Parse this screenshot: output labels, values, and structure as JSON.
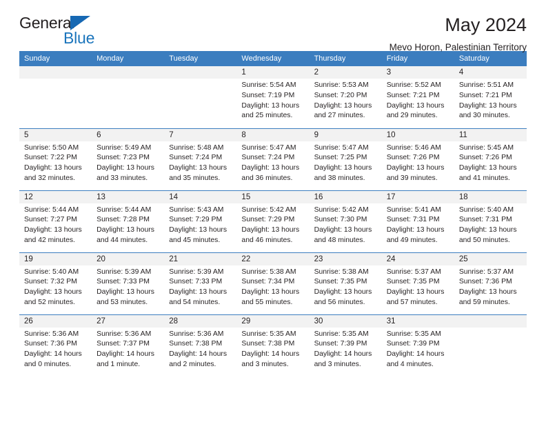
{
  "brand": {
    "name_primary": "General",
    "name_secondary": "Blue",
    "triangle_color": "#1668b3",
    "secondary_color": "#1b75bc"
  },
  "header": {
    "title": "May 2024",
    "subtitle": "Mevo Horon, Palestinian Territory"
  },
  "theme": {
    "header_row_bg": "#3b7dbf",
    "daynum_bg": "#f2f2f2",
    "text_color": "#231f20"
  },
  "calendar": {
    "weekday_headers": [
      "Sunday",
      "Monday",
      "Tuesday",
      "Wednesday",
      "Thursday",
      "Friday",
      "Saturday"
    ],
    "labels": {
      "sunrise": "Sunrise:",
      "sunset": "Sunset:",
      "daylight": "Daylight:"
    },
    "weeks": [
      [
        {
          "day": "",
          "blank": true
        },
        {
          "day": "",
          "blank": true
        },
        {
          "day": "",
          "blank": true
        },
        {
          "day": "1",
          "sunrise": "Sunrise: 5:54 AM",
          "sunset": "Sunset: 7:19 PM",
          "daylight": "Daylight: 13 hours and 25 minutes."
        },
        {
          "day": "2",
          "sunrise": "Sunrise: 5:53 AM",
          "sunset": "Sunset: 7:20 PM",
          "daylight": "Daylight: 13 hours and 27 minutes."
        },
        {
          "day": "3",
          "sunrise": "Sunrise: 5:52 AM",
          "sunset": "Sunset: 7:21 PM",
          "daylight": "Daylight: 13 hours and 29 minutes."
        },
        {
          "day": "4",
          "sunrise": "Sunrise: 5:51 AM",
          "sunset": "Sunset: 7:21 PM",
          "daylight": "Daylight: 13 hours and 30 minutes."
        }
      ],
      [
        {
          "day": "5",
          "sunrise": "Sunrise: 5:50 AM",
          "sunset": "Sunset: 7:22 PM",
          "daylight": "Daylight: 13 hours and 32 minutes."
        },
        {
          "day": "6",
          "sunrise": "Sunrise: 5:49 AM",
          "sunset": "Sunset: 7:23 PM",
          "daylight": "Daylight: 13 hours and 33 minutes."
        },
        {
          "day": "7",
          "sunrise": "Sunrise: 5:48 AM",
          "sunset": "Sunset: 7:24 PM",
          "daylight": "Daylight: 13 hours and 35 minutes."
        },
        {
          "day": "8",
          "sunrise": "Sunrise: 5:47 AM",
          "sunset": "Sunset: 7:24 PM",
          "daylight": "Daylight: 13 hours and 36 minutes."
        },
        {
          "day": "9",
          "sunrise": "Sunrise: 5:47 AM",
          "sunset": "Sunset: 7:25 PM",
          "daylight": "Daylight: 13 hours and 38 minutes."
        },
        {
          "day": "10",
          "sunrise": "Sunrise: 5:46 AM",
          "sunset": "Sunset: 7:26 PM",
          "daylight": "Daylight: 13 hours and 39 minutes."
        },
        {
          "day": "11",
          "sunrise": "Sunrise: 5:45 AM",
          "sunset": "Sunset: 7:26 PM",
          "daylight": "Daylight: 13 hours and 41 minutes."
        }
      ],
      [
        {
          "day": "12",
          "sunrise": "Sunrise: 5:44 AM",
          "sunset": "Sunset: 7:27 PM",
          "daylight": "Daylight: 13 hours and 42 minutes."
        },
        {
          "day": "13",
          "sunrise": "Sunrise: 5:44 AM",
          "sunset": "Sunset: 7:28 PM",
          "daylight": "Daylight: 13 hours and 44 minutes."
        },
        {
          "day": "14",
          "sunrise": "Sunrise: 5:43 AM",
          "sunset": "Sunset: 7:29 PM",
          "daylight": "Daylight: 13 hours and 45 minutes."
        },
        {
          "day": "15",
          "sunrise": "Sunrise: 5:42 AM",
          "sunset": "Sunset: 7:29 PM",
          "daylight": "Daylight: 13 hours and 46 minutes."
        },
        {
          "day": "16",
          "sunrise": "Sunrise: 5:42 AM",
          "sunset": "Sunset: 7:30 PM",
          "daylight": "Daylight: 13 hours and 48 minutes."
        },
        {
          "day": "17",
          "sunrise": "Sunrise: 5:41 AM",
          "sunset": "Sunset: 7:31 PM",
          "daylight": "Daylight: 13 hours and 49 minutes."
        },
        {
          "day": "18",
          "sunrise": "Sunrise: 5:40 AM",
          "sunset": "Sunset: 7:31 PM",
          "daylight": "Daylight: 13 hours and 50 minutes."
        }
      ],
      [
        {
          "day": "19",
          "sunrise": "Sunrise: 5:40 AM",
          "sunset": "Sunset: 7:32 PM",
          "daylight": "Daylight: 13 hours and 52 minutes."
        },
        {
          "day": "20",
          "sunrise": "Sunrise: 5:39 AM",
          "sunset": "Sunset: 7:33 PM",
          "daylight": "Daylight: 13 hours and 53 minutes."
        },
        {
          "day": "21",
          "sunrise": "Sunrise: 5:39 AM",
          "sunset": "Sunset: 7:33 PM",
          "daylight": "Daylight: 13 hours and 54 minutes."
        },
        {
          "day": "22",
          "sunrise": "Sunrise: 5:38 AM",
          "sunset": "Sunset: 7:34 PM",
          "daylight": "Daylight: 13 hours and 55 minutes."
        },
        {
          "day": "23",
          "sunrise": "Sunrise: 5:38 AM",
          "sunset": "Sunset: 7:35 PM",
          "daylight": "Daylight: 13 hours and 56 minutes."
        },
        {
          "day": "24",
          "sunrise": "Sunrise: 5:37 AM",
          "sunset": "Sunset: 7:35 PM",
          "daylight": "Daylight: 13 hours and 57 minutes."
        },
        {
          "day": "25",
          "sunrise": "Sunrise: 5:37 AM",
          "sunset": "Sunset: 7:36 PM",
          "daylight": "Daylight: 13 hours and 59 minutes."
        }
      ],
      [
        {
          "day": "26",
          "sunrise": "Sunrise: 5:36 AM",
          "sunset": "Sunset: 7:36 PM",
          "daylight": "Daylight: 14 hours and 0 minutes."
        },
        {
          "day": "27",
          "sunrise": "Sunrise: 5:36 AM",
          "sunset": "Sunset: 7:37 PM",
          "daylight": "Daylight: 14 hours and 1 minute."
        },
        {
          "day": "28",
          "sunrise": "Sunrise: 5:36 AM",
          "sunset": "Sunset: 7:38 PM",
          "daylight": "Daylight: 14 hours and 2 minutes."
        },
        {
          "day": "29",
          "sunrise": "Sunrise: 5:35 AM",
          "sunset": "Sunset: 7:38 PM",
          "daylight": "Daylight: 14 hours and 3 minutes."
        },
        {
          "day": "30",
          "sunrise": "Sunrise: 5:35 AM",
          "sunset": "Sunset: 7:39 PM",
          "daylight": "Daylight: 14 hours and 3 minutes."
        },
        {
          "day": "31",
          "sunrise": "Sunrise: 5:35 AM",
          "sunset": "Sunset: 7:39 PM",
          "daylight": "Daylight: 14 hours and 4 minutes."
        },
        {
          "day": "",
          "blank": true
        }
      ]
    ]
  }
}
